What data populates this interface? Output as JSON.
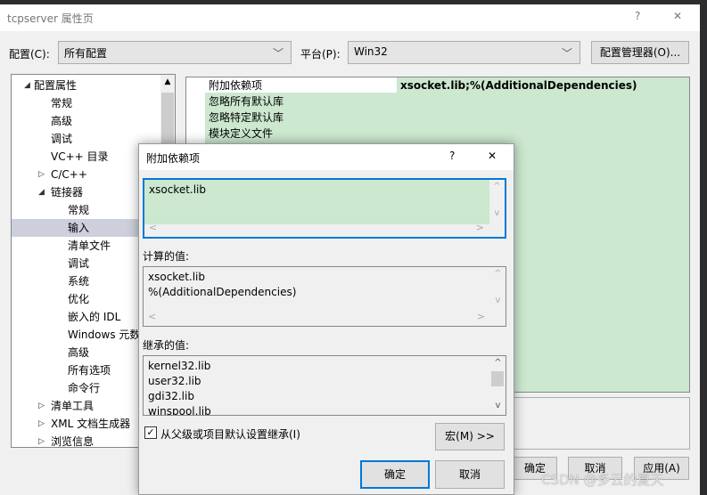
{
  "window": {
    "title": "tcpserver 属性页",
    "help": "?",
    "close": "✕"
  },
  "toolbar": {
    "config_label": "配置(C):",
    "config_value": "所有配置",
    "platform_label": "平台(P):",
    "platform_value": "Win32",
    "config_manager": "配置管理器(O)..."
  },
  "tree": [
    {
      "label": "配置属性",
      "level": 0,
      "arrow": "◢"
    },
    {
      "label": "常规",
      "level": 1
    },
    {
      "label": "高级",
      "level": 1
    },
    {
      "label": "调试",
      "level": 1
    },
    {
      "label": "VC++ 目录",
      "level": 1
    },
    {
      "label": "C/C++",
      "level": 1,
      "arrow": "▷"
    },
    {
      "label": "链接器",
      "level": 1,
      "arrow": "◢"
    },
    {
      "label": "常规",
      "level": 2
    },
    {
      "label": "输入",
      "level": 2,
      "selected": true
    },
    {
      "label": "清单文件",
      "level": 2
    },
    {
      "label": "调试",
      "level": 2
    },
    {
      "label": "系统",
      "level": 2
    },
    {
      "label": "优化",
      "level": 2
    },
    {
      "label": "嵌入的 IDL",
      "level": 2
    },
    {
      "label": "Windows 元数据",
      "level": 2
    },
    {
      "label": "高级",
      "level": 2
    },
    {
      "label": "所有选项",
      "level": 2
    },
    {
      "label": "命令行",
      "level": 2
    },
    {
      "label": "清单工具",
      "level": 1,
      "arrow": "▷"
    },
    {
      "label": "XML 文档生成器",
      "level": 1,
      "arrow": "▷"
    },
    {
      "label": "浏览信息",
      "level": 1,
      "arrow": "▷"
    }
  ],
  "grid": [
    {
      "label": "附加依赖项",
      "value": "xsocket.lib;%(AdditionalDependencies)"
    },
    {
      "label": "忽略所有默认库",
      "value": ""
    },
    {
      "label": "忽略特定默认库",
      "value": ""
    },
    {
      "label": "模块定义文件",
      "value": ""
    }
  ],
  "footer": {
    "ok": "确定",
    "cancel": "取消",
    "apply": "应用(A)"
  },
  "dialog": {
    "title": "附加依赖项",
    "help": "?",
    "close": "✕",
    "edit_value": "xsocket.lib",
    "computed_label": "计算的值:",
    "computed": [
      "xsocket.lib",
      "%(AdditionalDependencies)"
    ],
    "inherited_label": "继承的值:",
    "inherited": [
      "kernel32.lib",
      "user32.lib",
      "gdi32.lib",
      "winspool.lib"
    ],
    "inherit_checkbox": "从父级或项目默认设置继承(I)",
    "inherit_checked": true,
    "macros": "宏(M) >>",
    "ok": "确定",
    "cancel": "取消"
  },
  "watermark": "CSDN @多云的夏天"
}
